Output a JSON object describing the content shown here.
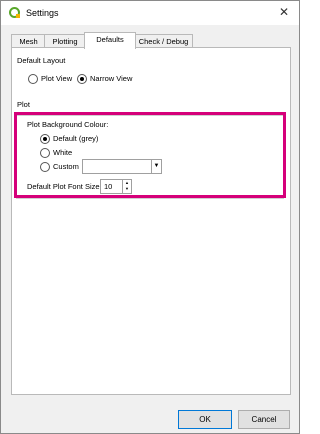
{
  "window": {
    "title": "Settings"
  },
  "tabs": [
    {
      "label": "Mesh"
    },
    {
      "label": "Plotting"
    },
    {
      "label": "Defaults"
    },
    {
      "label": "Check / Debug"
    }
  ],
  "default_layout": {
    "label": "Default Layout",
    "options": [
      "Plot View",
      "Narrow View"
    ],
    "selected": "Narrow View"
  },
  "plot": {
    "section_label": "Plot",
    "background_label": "Plot Background Colour:",
    "options": [
      "Default (grey)",
      "White",
      "Custom"
    ],
    "selected": "Default (grey)",
    "font_size_label": "Default Plot Font Size",
    "font_size_value": "10"
  },
  "highlight_color": "#d5007a",
  "buttons": {
    "ok": "OK",
    "cancel": "Cancel"
  }
}
